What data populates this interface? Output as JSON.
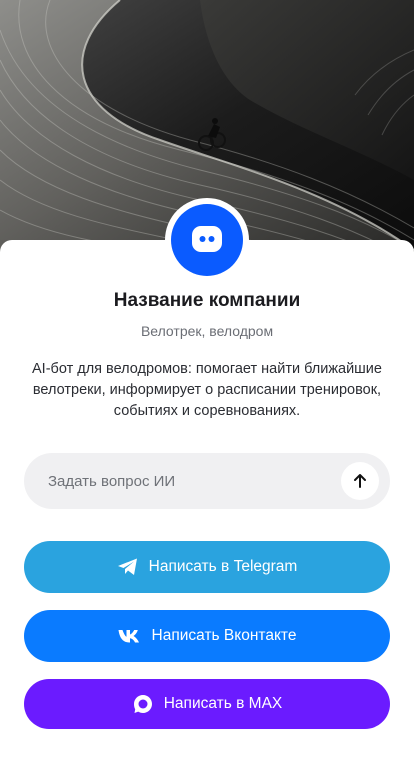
{
  "hero": {
    "image": "velodrome-track-cyclist"
  },
  "profile": {
    "avatar_icon": "bot-icon",
    "avatar_color": "#0a5bff",
    "title": "Название компании",
    "subtitle": "Велотрек, велодром",
    "description": "AI-бот для велодромов: помогает найти ближайшие велотреки, информирует о расписании тренировок, событиях и соревнованиях."
  },
  "ask": {
    "placeholder": "Задать вопрос ИИ",
    "value": "",
    "send_icon": "arrow-up-icon"
  },
  "buttons": [
    {
      "label": "Написать в Telegram",
      "icon": "telegram-icon",
      "color": "#2aa3df"
    },
    {
      "label": "Написать Вконтакте",
      "icon": "vk-icon",
      "color": "#0a7bff"
    },
    {
      "label": "Написать в MAX",
      "icon": "max-icon",
      "color": "#6b1bff"
    }
  ]
}
